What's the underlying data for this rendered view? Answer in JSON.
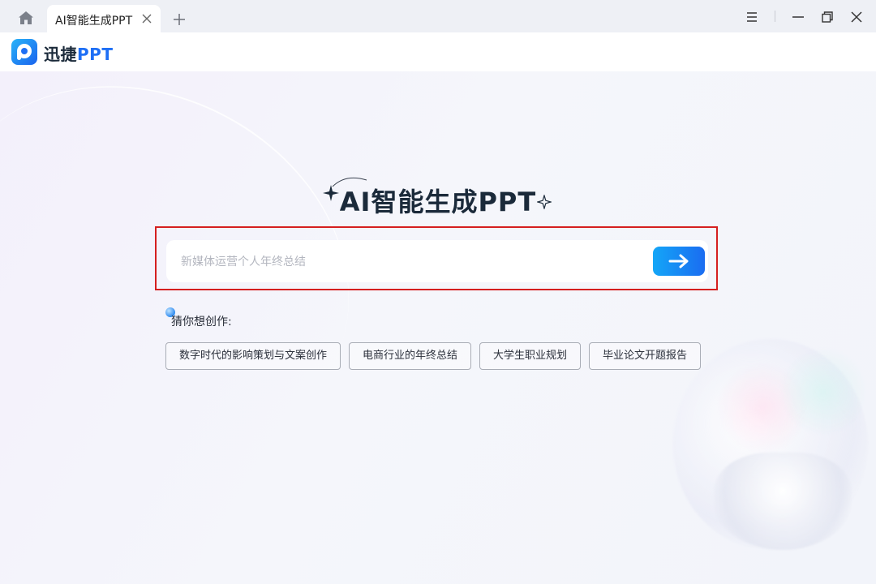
{
  "tabbar": {
    "home_icon": "home-icon",
    "active_tab": "AI智能生成PPT",
    "close_icon": "close-icon",
    "new_tab_icon": "plus-icon",
    "window_controls": [
      "menu-icon",
      "minimize-icon",
      "restore-icon",
      "close-icon"
    ]
  },
  "header": {
    "logo_icon": "app-logo-icon",
    "brand_prefix": "迅捷",
    "brand_suffix": "PPT",
    "brand_color": "#1e6ff5"
  },
  "hero": {
    "title": "AI智能生成PPT"
  },
  "search": {
    "placeholder": "新媒体运营个人年终总结",
    "value": "",
    "submit_icon": "arrow-right-icon",
    "outline_color": "#d51f1f"
  },
  "suggestions": {
    "label": "猜你想创作:",
    "items": [
      "数字时代的影响策划与文案创作",
      "电商行业的年终总结",
      "大学生职业规划",
      "毕业论文开题报告"
    ]
  }
}
